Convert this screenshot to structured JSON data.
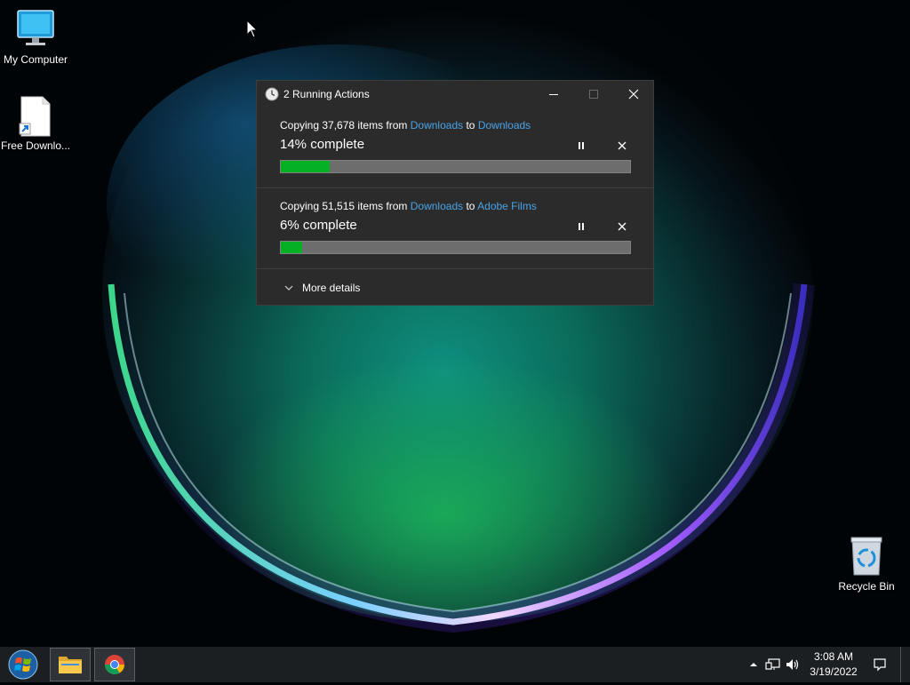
{
  "desktop": {
    "icons": [
      {
        "label": "My Computer",
        "icon": "monitor-icon"
      },
      {
        "label": "Free Downlo...",
        "icon": "file-shortcut-icon"
      },
      {
        "label": "Recycle Bin",
        "icon": "recycle-bin-icon"
      }
    ]
  },
  "dialog": {
    "title": "2 Running Actions",
    "operations": [
      {
        "prefix": "Copying 37,678 items from ",
        "source": "Downloads",
        "mid": " to ",
        "destination": "Downloads",
        "status": "14% complete",
        "progress": 0.14
      },
      {
        "prefix": "Copying 51,515 items from ",
        "source": "Downloads",
        "mid": " to ",
        "destination": "Adobe Films",
        "status": "6% complete",
        "progress": 0.06
      }
    ],
    "more_details": "More details"
  },
  "taskbar": {
    "apps": [
      "file-explorer-icon",
      "chrome-icon"
    ],
    "time": "3:08 AM",
    "date": "3/19/2022"
  },
  "colors": {
    "progress_fill": "#06b025",
    "link": "#4aa3e8",
    "dialog_bg": "#2b2b2b",
    "taskbar_bg": "#1c1f22"
  }
}
